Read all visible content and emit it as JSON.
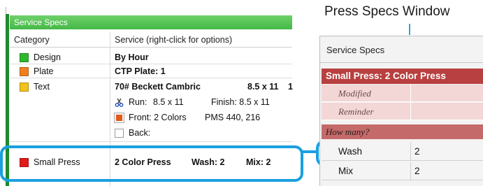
{
  "left_window": {
    "title": "Service Specs",
    "headers": {
      "category": "Category",
      "service": "Service  (right-click for options)"
    },
    "rows": [
      {
        "color": "#2db82d",
        "category": "Design",
        "service": "By Hour"
      },
      {
        "color": "#f07f1d",
        "category": "Plate",
        "service": "CTP Plate:  1"
      },
      {
        "color": "#f2c21a",
        "category": "Text",
        "service": "70# Beckett Cambric",
        "size": "8.5 x 11",
        "qty": "1"
      }
    ],
    "details": {
      "run_label": "Run:",
      "run_size": "8.5 x 11",
      "finish_label": "Finish: 8.5 x 11",
      "front_label": "Front: 2 Colors",
      "front_pms": "PMS 440, 216",
      "back_label": "Back:"
    },
    "small_press": {
      "color": "#e11b1b",
      "category": "Small Press",
      "service": "2 Color Press",
      "wash": "Wash: 2",
      "mix": "Mix: 2"
    }
  },
  "right_window": {
    "caption": "Press Specs Window",
    "title": "Service Specs",
    "section_title": "Small Press: 2 Color Press",
    "rows": [
      {
        "label": "Modified"
      },
      {
        "label": "Reminder"
      }
    ],
    "subsection": "How many?",
    "fields": [
      {
        "label": "Wash",
        "value": "2"
      },
      {
        "label": "Mix",
        "value": "2"
      }
    ]
  },
  "colors": {
    "accent_blue": "#1aa0e0",
    "title_green": "#45b947",
    "section_red": "#b84040"
  }
}
